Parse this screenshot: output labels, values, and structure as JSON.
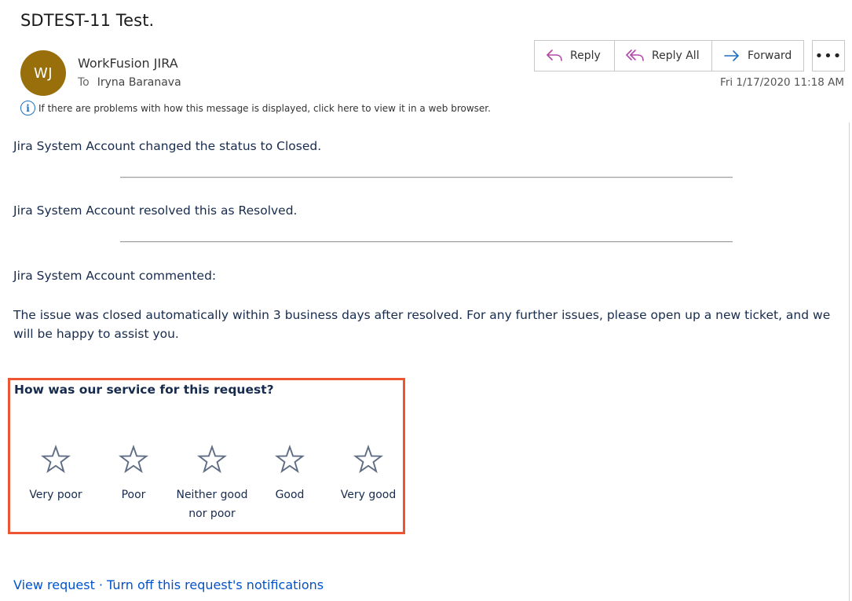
{
  "email": {
    "subject": "SDTEST-11 Test.",
    "avatar_initials": "WJ",
    "avatar_color": "#986f0b",
    "sender": "WorkFusion JIRA",
    "to_label": "To",
    "recipient": "Iryna Baranava",
    "timestamp": "Fri 1/17/2020 11:18 AM",
    "info_message": "If there are problems with how this message is displayed, click here to view it in a web browser."
  },
  "toolbar": {
    "reply_label": "Reply",
    "reply_all_label": "Reply All",
    "forward_label": "Forward",
    "more_label": "•••",
    "accent_reply": "#b04aa8",
    "accent_forward": "#1f6fbf"
  },
  "body": {
    "status_change": "Jira System Account changed the status to Closed.",
    "resolution": "Jira System Account resolved this as Resolved.",
    "comment_header": "Jira System Account commented:",
    "comment_text": "The issue was closed automatically within 3 business days after resolved. For any further issues, please open up a new ticket, and we will be happy to assist you."
  },
  "rating": {
    "question": "How was our service for this request?",
    "highlight_color": "#ee5533",
    "options": [
      {
        "label": "Very poor"
      },
      {
        "label": "Poor"
      },
      {
        "label": "Neither good nor poor"
      },
      {
        "label": "Good"
      },
      {
        "label": "Very good"
      }
    ]
  },
  "footer": {
    "view_request": "View request",
    "separator": "·",
    "turn_off": "Turn off this request's notifications"
  }
}
